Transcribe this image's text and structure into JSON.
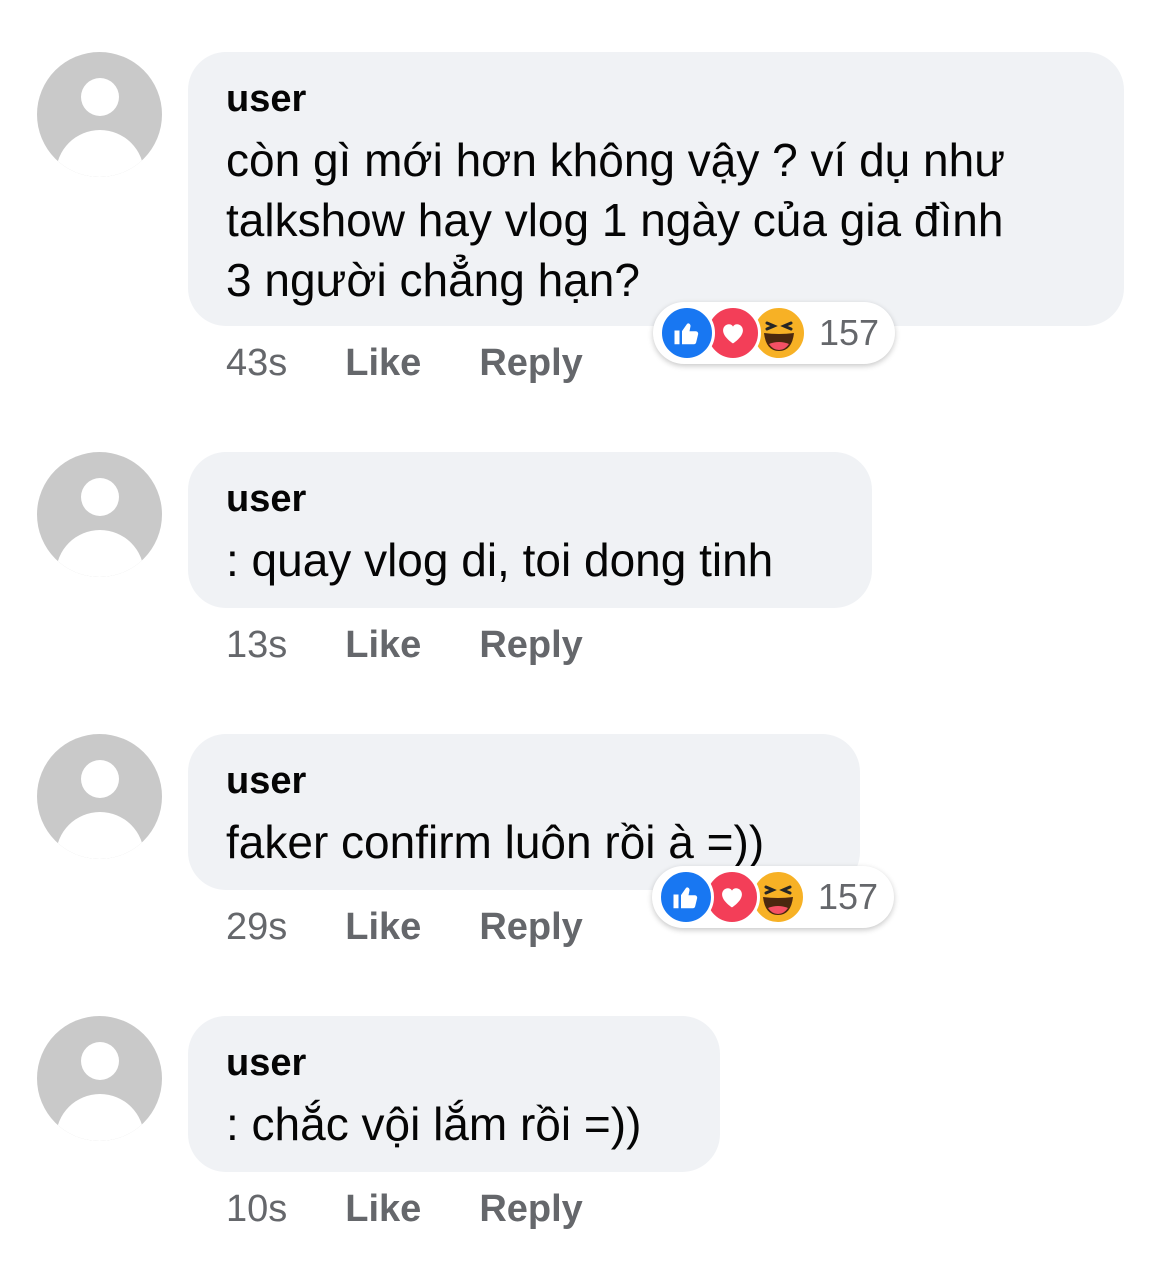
{
  "comments": [
    {
      "username": "user",
      "lines": [
        "còn gì mới hơn không vậy ? ví dụ như",
        "talkshow hay vlog 1 ngày của gia đình",
        "3 người chẳng hạn?"
      ],
      "time": "43s",
      "like_label": "Like",
      "reply_label": "Reply",
      "reaction_count": "157"
    },
    {
      "username": "user",
      "lines": [
        ": quay vlog di, toi dong tinh"
      ],
      "time": "13s",
      "like_label": "Like",
      "reply_label": "Reply"
    },
    {
      "username": "user",
      "lines": [
        "faker confirm luôn rồi à =))"
      ],
      "time": "29s",
      "like_label": "Like",
      "reply_label": "Reply",
      "reaction_count": "157"
    },
    {
      "username": "user",
      "lines": [
        ": chắc vội lắm rồi =))"
      ],
      "time": "10s",
      "like_label": "Like",
      "reply_label": "Reply"
    }
  ],
  "colors": {
    "bubble": "#f0f2f5",
    "meta_text": "#65676b",
    "like_blue": "#1877f2",
    "love_red": "#f33e58",
    "haha_yellow": "#f7b125"
  },
  "icons": {
    "avatar": "default-user-avatar-icon",
    "reactions": [
      "like-reaction-icon",
      "love-reaction-icon",
      "haha-reaction-icon"
    ]
  }
}
